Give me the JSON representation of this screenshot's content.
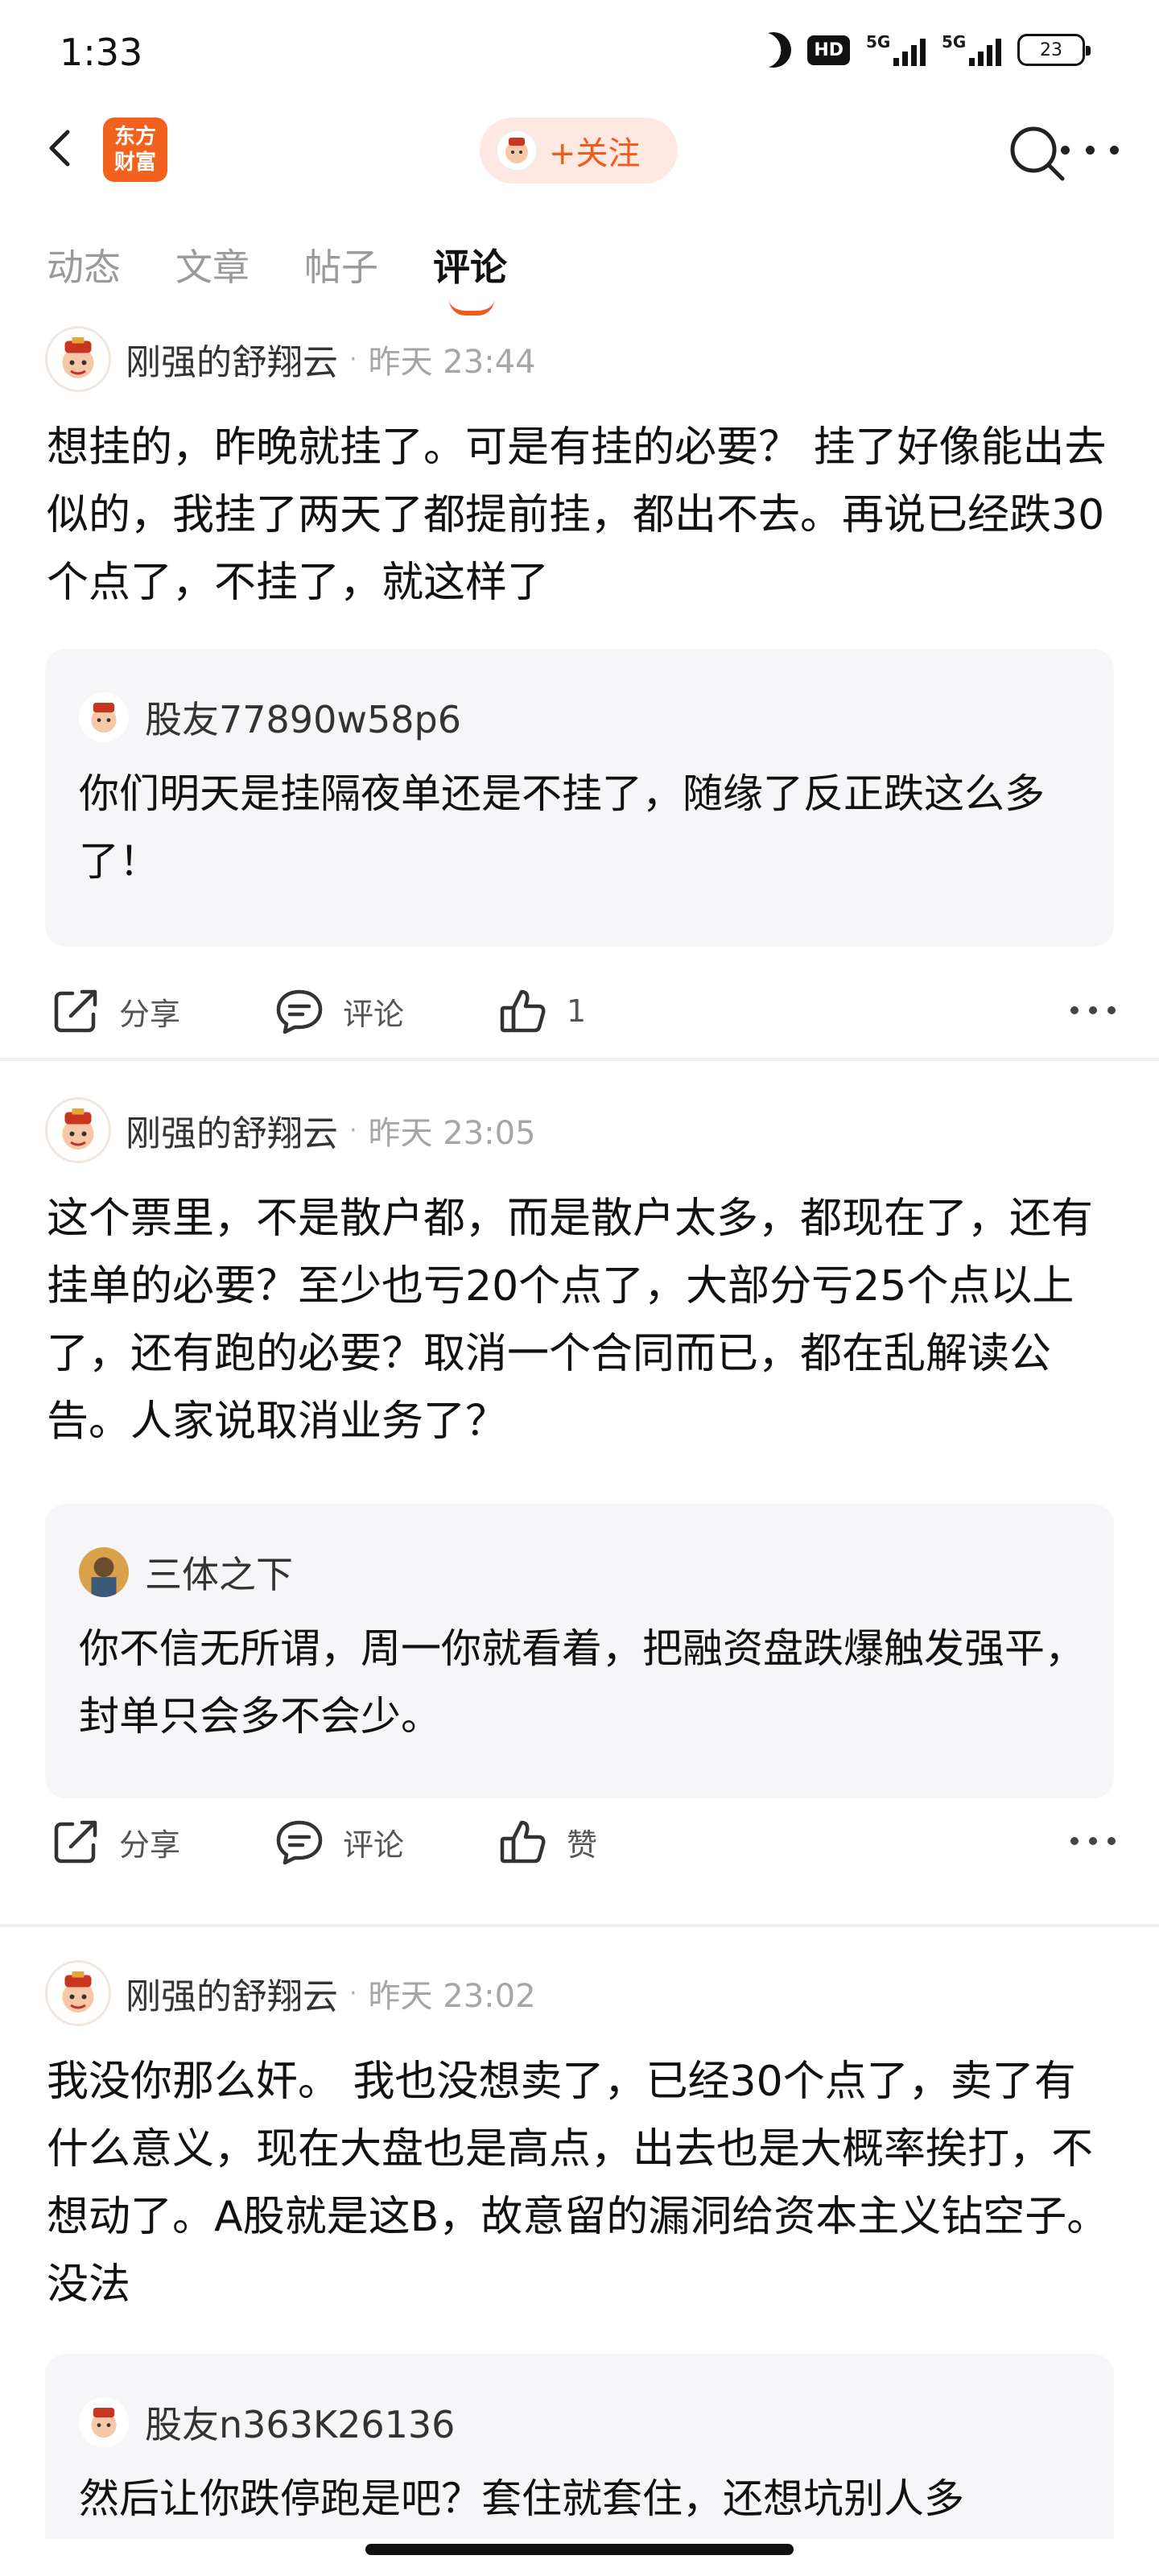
{
  "status": {
    "time": "1:33",
    "hd": "HD",
    "sig1": "5G",
    "sig2": "5G",
    "battery": "23"
  },
  "nav": {
    "logo_line1": "东方",
    "logo_line2": "财富",
    "follow_label": "+关注"
  },
  "tabs": [
    {
      "label": "动态"
    },
    {
      "label": "文章"
    },
    {
      "label": "帖子"
    },
    {
      "label": "评论"
    }
  ],
  "posts": [
    {
      "author": "刚强的舒翔云",
      "dot": "·",
      "time": "昨天 23:44",
      "content": "想挂的，昨晚就挂了。可是有挂的必要？ 挂了好像能出去似的，我挂了两天了都提前挂，都出不去。再说已经跌30个点了，不挂了，就这样了",
      "reply_author": "股友77890w58p6",
      "reply_text": "你们明天是挂隔夜单还是不挂了，随缘了反正跌这么多了！",
      "share": "分享",
      "comment": "评论",
      "like": "1"
    },
    {
      "author": "刚强的舒翔云",
      "dot": "·",
      "time": "昨天 23:05",
      "content": "这个票里，不是散户都，而是散户太多，都现在了，还有挂单的必要？至少也亏20个点了，大部分亏25个点以上了，还有跑的必要？取消一个合同而已，都在乱解读公告。人家说取消业务了？",
      "reply_author": "三体之下",
      "reply_text": "你不信无所谓，周一你就看着，把融资盘跌爆触发强平，封单只会多不会少。",
      "share": "分享",
      "comment": "评论",
      "like": "赞"
    },
    {
      "author": "刚强的舒翔云",
      "dot": "·",
      "time": "昨天 23:02",
      "content": "我没你那么奸。 我也没想卖了，已经30个点了，卖了有什么意义，现在大盘也是高点，出去也是大概率挨打，不想动了。A股就是这B，故意留的漏洞给资本主义钻空子。没法",
      "reply_author": "股友n363K26136",
      "reply_text": "然后让你跌停跑是吧？套住就套住，还想坑别人多"
    }
  ],
  "colors": {
    "accent": "#f25a1c",
    "logo": "#f2611d",
    "reply_bg": "#f6f6f8"
  }
}
